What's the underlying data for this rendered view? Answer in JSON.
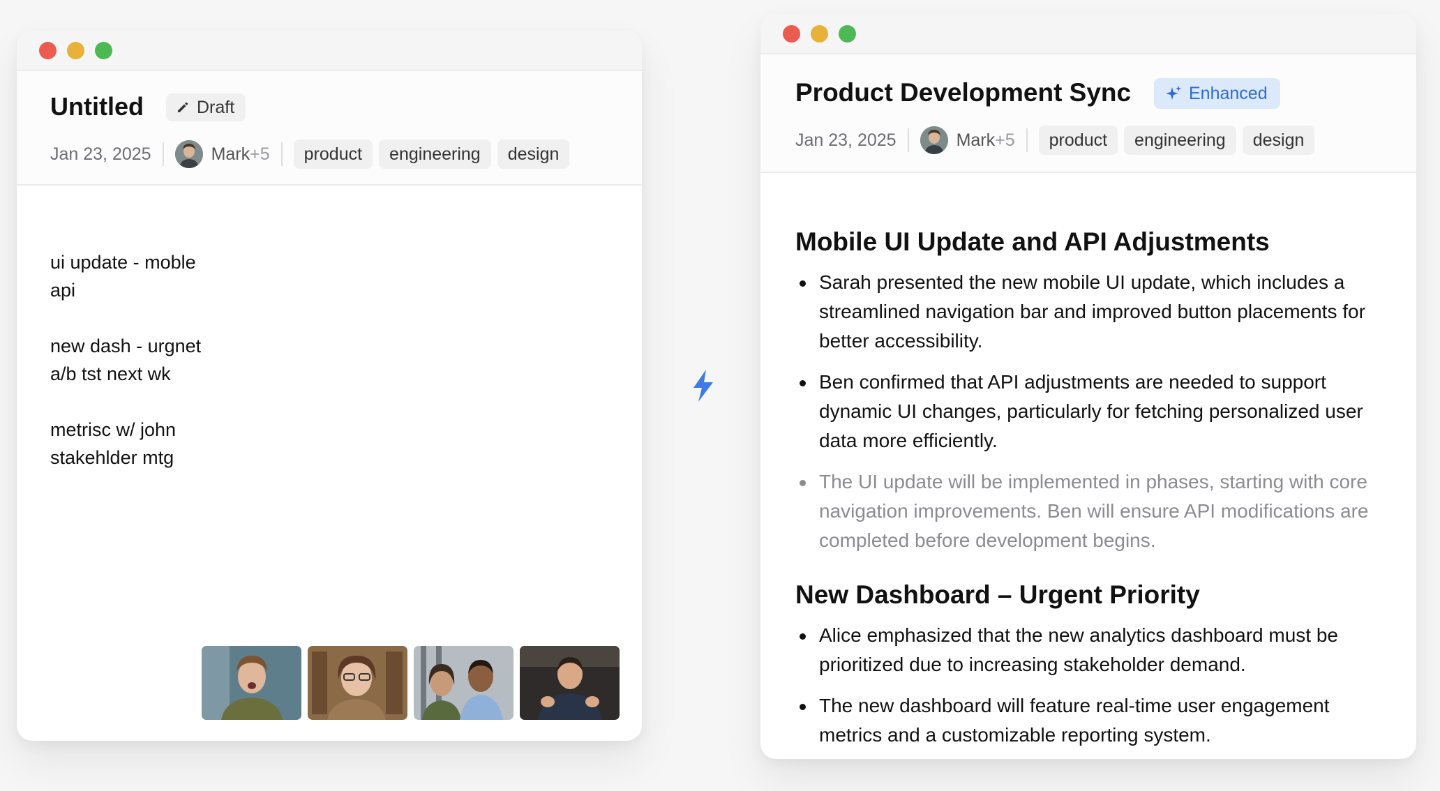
{
  "draft_note": {
    "title": "Untitled",
    "badge_label": "Draft",
    "badge_icon": "pencil-icon",
    "date": "Jan 23, 2025",
    "people_name": "Mark",
    "people_extra": "+5",
    "tags": [
      "product",
      "engineering",
      "design"
    ],
    "notes": [
      [
        "ui update - moble",
        "api"
      ],
      [
        "new dash - urgnet",
        "a/b tst next wk"
      ],
      [
        "metrisc w/ john",
        "stakehlder mtg"
      ]
    ],
    "participant_thumbnails": [
      "participant-1",
      "participant-2",
      "participant-3",
      "participant-4"
    ]
  },
  "transform_icon": "lightning-bolt-icon",
  "enhanced_note": {
    "title": "Product Development Sync",
    "badge_label": "Enhanced",
    "badge_icon": "sparkles-icon",
    "date": "Jan 23, 2025",
    "people_name": "Mark",
    "people_extra": "+5",
    "tags": [
      "product",
      "engineering",
      "design"
    ],
    "sections": [
      {
        "heading": "Mobile UI Update and API Adjustments",
        "bullets": [
          "Sarah presented the new mobile UI update, which includes a streamlined navigation bar and improved button placements for better accessibility.",
          "Ben confirmed that API adjustments are needed to support dynamic UI changes, particularly for fetching personalized user data more efficiently.",
          "The UI update will be implemented in phases, starting with core navigation improvements. Ben will ensure API modifications are completed before development begins."
        ]
      },
      {
        "heading": "New Dashboard – Urgent Priority",
        "bullets": [
          "Alice emphasized that the new analytics dashboard must be prioritized due to increasing stakeholder demand.",
          "The new dashboard will feature real-time user engagement metrics and a customizable reporting system."
        ]
      }
    ]
  },
  "colors": {
    "accent_blue": "#2d6bd8",
    "enhanced_badge_bg": "#dce9fb",
    "traffic_red": "#ec5b4f",
    "traffic_yellow": "#e8b13a",
    "traffic_green": "#4cb955"
  }
}
